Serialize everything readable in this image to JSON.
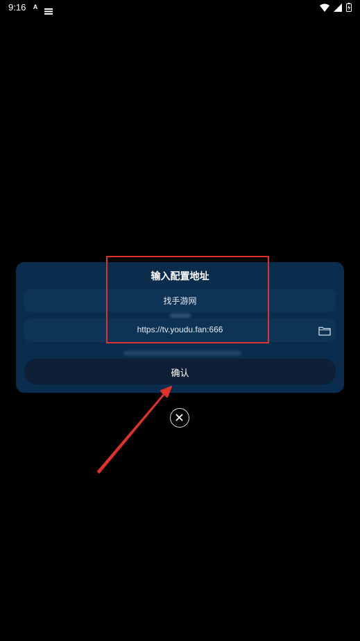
{
  "status_bar": {
    "time": "9:16",
    "app_letter": "A"
  },
  "dialog": {
    "title": "输入配置地址",
    "name_value": "找手游网",
    "url_value": "https://tv.youdu.fan:666",
    "confirm_label": "确认"
  },
  "colors": {
    "background": "#000000",
    "dialog_bg": "#0a2c4d",
    "field_bg": "#0d3355",
    "button_bg": "#0f1f35",
    "annotation_red": "#e2312c"
  },
  "icons": {
    "folder": "folder-icon",
    "close": "close-icon",
    "wifi": "wifi-icon",
    "signal": "signal-icon",
    "battery": "battery-icon"
  }
}
